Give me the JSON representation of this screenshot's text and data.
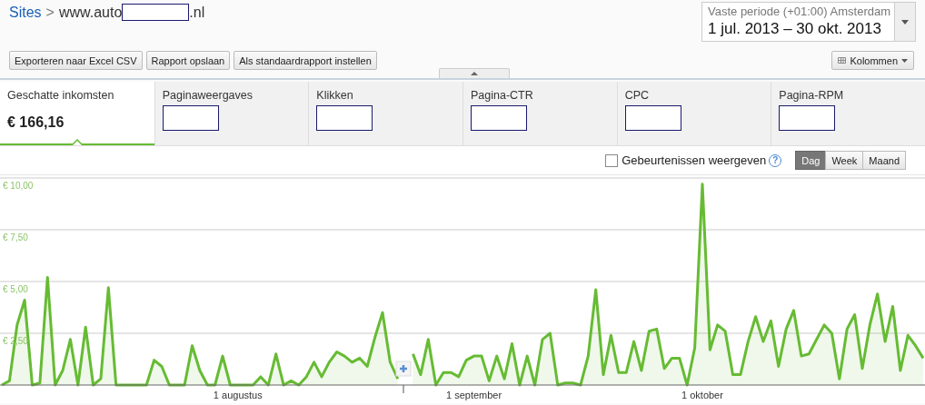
{
  "breadcrumb": {
    "root": "Sites",
    "separator": ">",
    "site_prefix": "www.auto",
    "site_suffix": ".nl"
  },
  "date_range": {
    "label": "Vaste periode (+01:00) Amsterdam",
    "value": "1 jul. 2013 – 30 okt. 2013"
  },
  "toolbar": {
    "buttons": [
      "Exporteren naar Excel CSV",
      "Rapport opslaan",
      "Als standaardrapport instellen"
    ],
    "columns_button": "Kolommen"
  },
  "metrics": [
    {
      "label": "Geschatte inkomsten",
      "value": "€ 166,16",
      "selected": true,
      "kind": "value"
    },
    {
      "label": "Paginaweergaves",
      "selected": false,
      "kind": "redacted"
    },
    {
      "label": "Klikken",
      "selected": false,
      "kind": "redacted"
    },
    {
      "label": "Pagina-CTR",
      "selected": false,
      "kind": "redacted"
    },
    {
      "label": "CPC",
      "selected": false,
      "kind": "redacted"
    },
    {
      "label": "Pagina-RPM",
      "selected": false,
      "kind": "redacted"
    }
  ],
  "events": {
    "label": "Gebeurtenissen weergeven",
    "checked": false,
    "help": "?"
  },
  "granularity": [
    {
      "label": "Dag",
      "selected": true
    },
    {
      "label": "Week",
      "selected": false
    },
    {
      "label": "Maand",
      "selected": false
    }
  ],
  "chart_data": {
    "type": "area",
    "grid": true,
    "categories": [
      null,
      null,
      null,
      null,
      null,
      null,
      null,
      null,
      null,
      null,
      null,
      null,
      null,
      null,
      null,
      null,
      null,
      null,
      null,
      null,
      null,
      null,
      null,
      null,
      null,
      null,
      null,
      null,
      null,
      null,
      null,
      "1 augustus",
      null,
      null,
      null,
      null,
      null,
      null,
      null,
      null,
      null,
      null,
      null,
      null,
      null,
      null,
      null,
      null,
      null,
      null,
      null,
      null,
      null,
      null,
      null,
      null,
      null,
      null,
      null,
      null,
      null,
      null,
      "1 september",
      null,
      null,
      null,
      null,
      null,
      null,
      null,
      null,
      null,
      null,
      null,
      null,
      null,
      null,
      null,
      null,
      null,
      null,
      null,
      null,
      null,
      null,
      null,
      null,
      null,
      null,
      null,
      null,
      null,
      "1 oktober",
      null,
      null,
      null,
      null,
      null,
      null,
      null,
      null,
      null,
      null,
      null,
      null,
      null,
      null,
      null,
      null,
      null,
      null,
      null,
      null,
      null,
      null,
      null,
      null,
      null,
      null,
      null,
      null,
      null
    ],
    "ylim": [
      0,
      10
    ],
    "yticks": [
      {
        "value": 2.5,
        "label": "€ 2,50"
      },
      {
        "value": 5,
        "label": "€ 5,00"
      },
      {
        "value": 7.5,
        "label": "€ 7,50"
      },
      {
        "value": 10,
        "label": "€ 10,00"
      }
    ],
    "series": [
      {
        "color": "#66bb33",
        "values": [
          0,
          0.2,
          2.9,
          4.1,
          0,
          0.1,
          5.2,
          0,
          0.7,
          2.2,
          0,
          2.8,
          0,
          0.3,
          4.7,
          0,
          0,
          0,
          0,
          0,
          1.2,
          0.9,
          0,
          0,
          0,
          1.9,
          0.7,
          0,
          0,
          1.4,
          0,
          0,
          0,
          0,
          0.4,
          0,
          1.5,
          0,
          0.2,
          0,
          0.4,
          1.1,
          0.4,
          1.1,
          1.6,
          1.4,
          1.1,
          1.3,
          0.9,
          2.3,
          3.5,
          1.1,
          0.3,
          null,
          1.5,
          0.5,
          2.2,
          0,
          0.6,
          0.6,
          0.4,
          1.2,
          1.4,
          1.4,
          0.2,
          1.4,
          0.3,
          2.0,
          0,
          1.4,
          0,
          2.2,
          2.5,
          0,
          0.1,
          0.1,
          0,
          1.4,
          4.6,
          0.5,
          2.4,
          0.6,
          0.6,
          2.1,
          0.7,
          2.6,
          2.7,
          0.8,
          1.3,
          1.3,
          0,
          1.8,
          9.7,
          1.7,
          2.9,
          2.6,
          0.5,
          0.5,
          2.1,
          3.3,
          2.1,
          3.1,
          0.9,
          2.7,
          3.6,
          1.4,
          1.5,
          2.2,
          2.9,
          2.5,
          0.3,
          2.7,
          3.4,
          0.8,
          2.9,
          4.4,
          2.1,
          3.8,
          0.7,
          2.4,
          1.9,
          1.3
        ]
      }
    ]
  }
}
